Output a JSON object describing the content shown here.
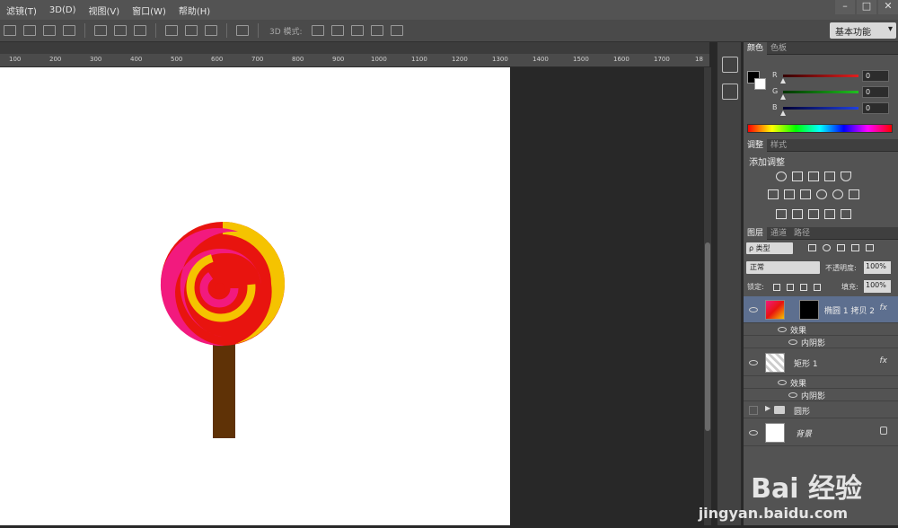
{
  "menu": {
    "items": [
      "滤镜(T)",
      "3D(D)",
      "视图(V)",
      "窗口(W)",
      "帮助(H)"
    ]
  },
  "window_controls": {
    "minimize": "–",
    "restore": "□",
    "close": "✕"
  },
  "options_bar": {
    "mode_label": "3D 模式:",
    "workspace": "基本功能"
  },
  "ruler": {
    "labels": [
      "100",
      "200",
      "300",
      "400",
      "500",
      "600",
      "700",
      "800",
      "900",
      "1000",
      "1100",
      "1200",
      "1300",
      "1400",
      "1500",
      "1600",
      "1700",
      "18"
    ]
  },
  "color_panel": {
    "tabs": [
      "颜色",
      "色板"
    ],
    "channels": [
      {
        "label": "R",
        "value": "0",
        "color": "#e02020"
      },
      {
        "label": "G",
        "value": "0",
        "color": "#20c020"
      },
      {
        "label": "B",
        "value": "0",
        "color": "#2040e0"
      }
    ]
  },
  "adjustments_panel": {
    "tabs": [
      "调整",
      "样式"
    ],
    "title": "添加调整"
  },
  "layers_panel": {
    "tabs": [
      "图层",
      "通道",
      "路径"
    ],
    "filter_label": "ρ 类型",
    "blend_mode": "正常",
    "opacity_label": "不透明度:",
    "opacity_value": "100%",
    "lock_label": "锁定:",
    "fill_label": "填充:",
    "fill_value": "100%",
    "layers": [
      {
        "name": "椭圆 1 拷贝 2",
        "fx": "fx",
        "effects_label": "效果",
        "effect": "内阴影",
        "selected": true
      },
      {
        "name": "矩形 1",
        "fx": "fx",
        "effects_label": "效果",
        "effect": "内阴影",
        "selected": false
      },
      {
        "name": "圆形",
        "group": true
      },
      {
        "name": "背景",
        "locked": true
      }
    ]
  },
  "watermark": {
    "brand": "Bai 经验",
    "url": "jingyan.baidu.com"
  },
  "colors": {
    "accent_selected": "#5d6f8f",
    "lollipop_red": "#e8140f",
    "lollipop_pink": "#f21a7e",
    "lollipop_yellow": "#f5c300",
    "stick_brown": "#5f3206"
  }
}
